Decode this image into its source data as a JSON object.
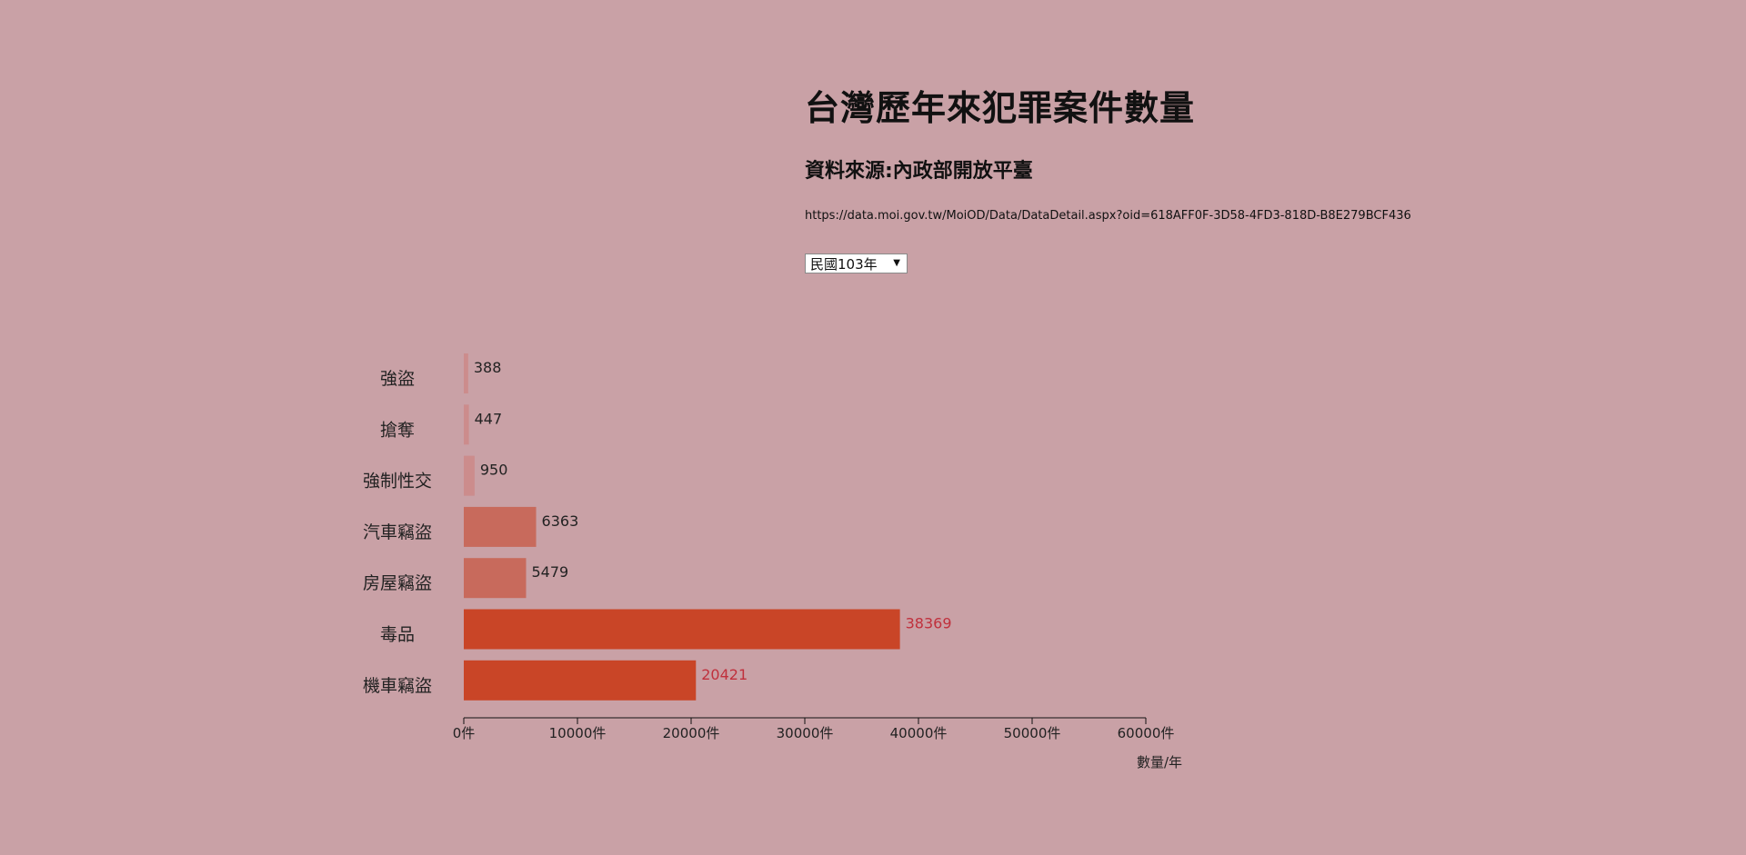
{
  "header": {
    "title": "台灣歷年來犯罪案件數量",
    "source": "資料來源:內政部開放平臺",
    "url": "https://data.moi.gov.tw/MoiOD/Data/DataDetail.aspx?oid=618AFF0F-3D58-4FD3-818D-B8E279BCF436"
  },
  "year_select": {
    "selected": "民國103年"
  },
  "chart_data": {
    "type": "bar",
    "orientation": "horizontal",
    "categories": [
      "強盜",
      "搶奪",
      "強制性交",
      "汽車竊盜",
      "房屋竊盜",
      "毒品",
      "機車竊盜"
    ],
    "values": [
      388,
      447,
      950,
      6363,
      5479,
      38369,
      20421
    ],
    "xlim": [
      0,
      60000
    ],
    "xticks": [
      0,
      10000,
      20000,
      30000,
      40000,
      50000,
      60000
    ],
    "xtick_labels": [
      "0件",
      "10000件",
      "20000件",
      "30000件",
      "40000件",
      "50000件",
      "60000件"
    ],
    "xlabel": "數量/年",
    "colors": {
      "low": "#cc8c8c",
      "mid": "#c86a5c",
      "high": "#c94527",
      "label_default": "#222222",
      "label_high": "#c0303c"
    }
  }
}
